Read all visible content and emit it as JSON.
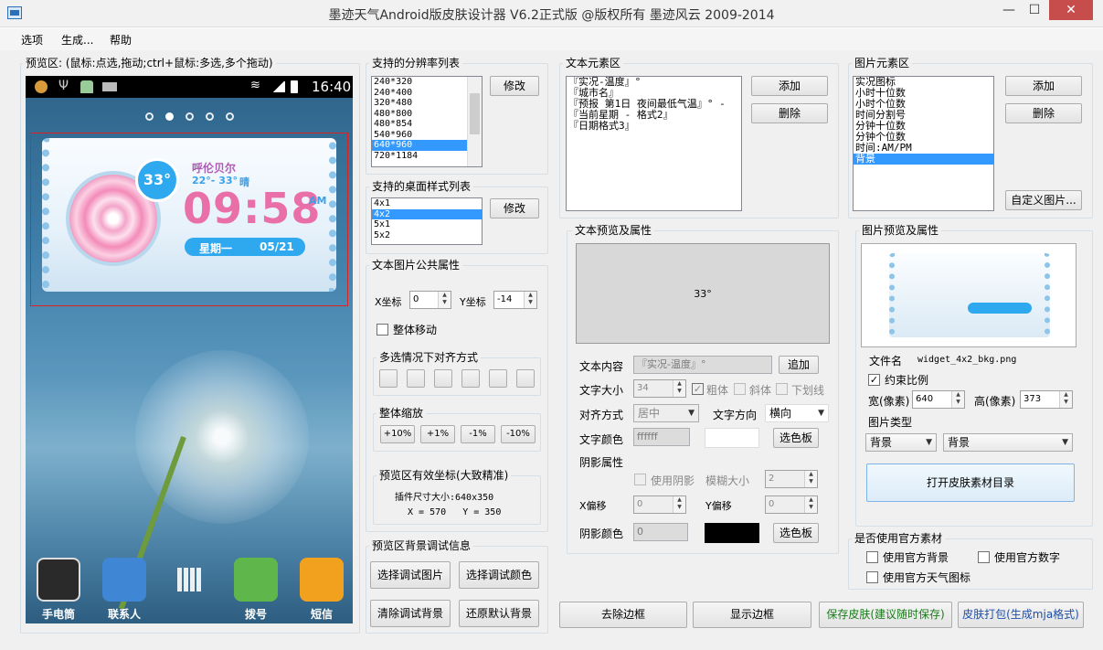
{
  "window": {
    "title": "墨迹天气Android版皮肤设计器 V6.2正式版 @版权所有 墨迹风云 2009-2014",
    "minimize": "—",
    "maximize": "☐",
    "close": "✕"
  },
  "menu": [
    "选项",
    "生成...",
    "帮助"
  ],
  "preview": {
    "label": "预览区: (鼠标:点选,拖动;ctrl+鼠标:多选,多个拖动)",
    "status_time": "16:40",
    "widget": {
      "temp": "33°",
      "city": "呼伦贝尔",
      "range": "22°- 33°",
      "weather": "晴",
      "time": "09:58",
      "ampm": "AM",
      "weekday": "星期一",
      "date": "05/21"
    },
    "dock": [
      "手电筒",
      "联系人",
      "",
      "拨号",
      "短信"
    ]
  },
  "resolutions": {
    "label": "支持的分辨率列表",
    "items": [
      "240*320",
      "240*400",
      "320*480",
      "480*800",
      "480*854",
      "540*960",
      "640*960",
      "720*1184"
    ],
    "selected": "640*960",
    "edit": "修改"
  },
  "desktop_styles": {
    "label": "支持的桌面样式列表",
    "items": [
      "4x1",
      "4x2",
      "5x1",
      "5x2"
    ],
    "selected": "4x2",
    "edit": "修改"
  },
  "common": {
    "label": "文本图片公共属性",
    "x_label": "X坐标",
    "x_value": "0",
    "y_label": "Y坐标",
    "y_value": "-14",
    "move_all": "整体移动",
    "align_label": "多选情况下对齐方式",
    "scale_label": "整体缩放",
    "scale_buttons": [
      "+10%",
      "+1%",
      "-1%",
      "-10%"
    ],
    "coord_label": "预览区有效坐标(大致精准)",
    "plugin_size": "插件尺寸大小:640x350",
    "coords": "X = 570   Y = 350"
  },
  "bg_debug": {
    "label": "预览区背景调试信息",
    "buttons": [
      "选择调试图片",
      "选择调试颜色",
      "清除调试背景",
      "还原默认背景"
    ]
  },
  "text_elements": {
    "label": "文本元素区",
    "items": [
      "『实况-温度』°",
      "『城市名』",
      "『预报 第1日 夜间最低气温』°  -",
      "『当前星期 - 格式2』",
      "『日期格式3』"
    ],
    "add": "添加",
    "delete": "删除"
  },
  "text_preview": {
    "label": "文本预览及属性",
    "sample": "33°",
    "content_label": "文本内容",
    "content_value": "『实况-温度』°",
    "append": "追加",
    "size_label": "文字大小",
    "size_value": "34",
    "bold": "粗体",
    "italic": "斜体",
    "underline": "下划线",
    "align_label": "对齐方式",
    "align_value": "居中",
    "direction_label": "文字方向",
    "direction_value": "横向",
    "color_label": "文字颜色",
    "color_value": "ffffff",
    "palette": "选色板",
    "shadow_label": "阴影属性",
    "use_shadow": "使用阴影",
    "blur_label": "模糊大小",
    "blur_value": "2",
    "xoff_label": "X偏移",
    "xoff_value": "0",
    "yoff_label": "Y偏移",
    "yoff_value": "0",
    "shadow_color_label": "阴影颜色",
    "shadow_color_value": "0",
    "palette2": "选色板"
  },
  "image_elements": {
    "label": "图片元素区",
    "items": [
      "实况图标",
      "小时十位数",
      "小时个位数",
      "时间分割号",
      "分钟十位数",
      "分钟个位数",
      "时间:AM/PM",
      "背景"
    ],
    "selected": "背景",
    "add": "添加",
    "delete": "删除",
    "custom": "自定义图片..."
  },
  "image_preview": {
    "label": "图片预览及属性",
    "file_label": "文件名",
    "file_value": "widget_4x2_bkg.png",
    "keep_ratio": "约束比例",
    "width_label": "宽(像素)",
    "width_value": "640",
    "height_label": "高(像素)",
    "height_value": "373",
    "type_label": "图片类型",
    "type_value1": "背景",
    "type_value2": "背景",
    "open_dir": "打开皮肤素材目录"
  },
  "official": {
    "label": "是否使用官方素材",
    "bg": "使用官方背景",
    "digits": "使用官方数字",
    "icons": "使用官方天气图标"
  },
  "bottom": {
    "remove_border": "去除边框",
    "show_border": "显示边框",
    "save": "保存皮肤(建议随时保存)",
    "pack": "皮肤打包(生成mja格式)"
  },
  "colors": {
    "accent": "#3399ff",
    "save_text": "#1a7a1a",
    "pack_text": "#1e4fa8"
  }
}
